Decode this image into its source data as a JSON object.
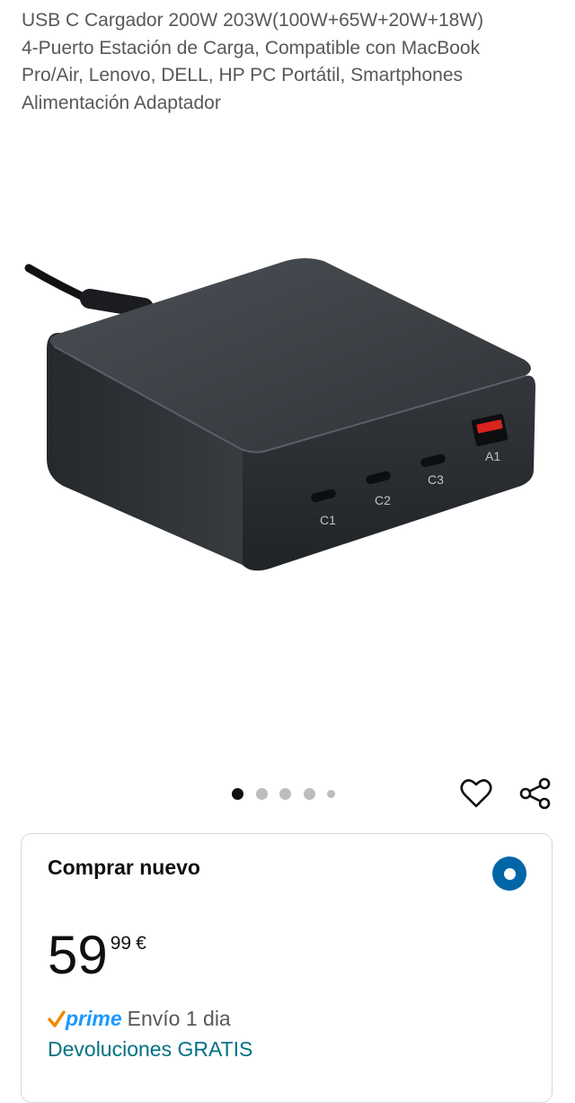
{
  "product": {
    "title_lines": [
      "USB C Cargador 200W 203W(100W+65W+20W+18W)",
      "4-Puerto Estación de Carga, Compatible con MacBook",
      "Pro/Air, Lenovo, DELL, HP PC Portátil, Smartphones",
      "Alimentación Adaptador"
    ],
    "port_labels": [
      "C1",
      "C2",
      "C3",
      "A1"
    ]
  },
  "carousel": {
    "total_images": 5,
    "active_index": 0
  },
  "actions": {
    "favorite_icon": "heart-icon",
    "share_icon": "share-icon"
  },
  "buy_box": {
    "heading": "Comprar nuevo",
    "selected": true,
    "price": {
      "whole": "59",
      "fraction": "99",
      "currency": "€"
    },
    "prime_label": "prime",
    "shipping": "Envío 1 dia",
    "returns": "Devoluciones GRATIS"
  },
  "colors": {
    "accent_blue": "#0066a8",
    "prime_blue": "#1a98ff",
    "prime_check": "#f08804",
    "link_teal": "#007185"
  }
}
